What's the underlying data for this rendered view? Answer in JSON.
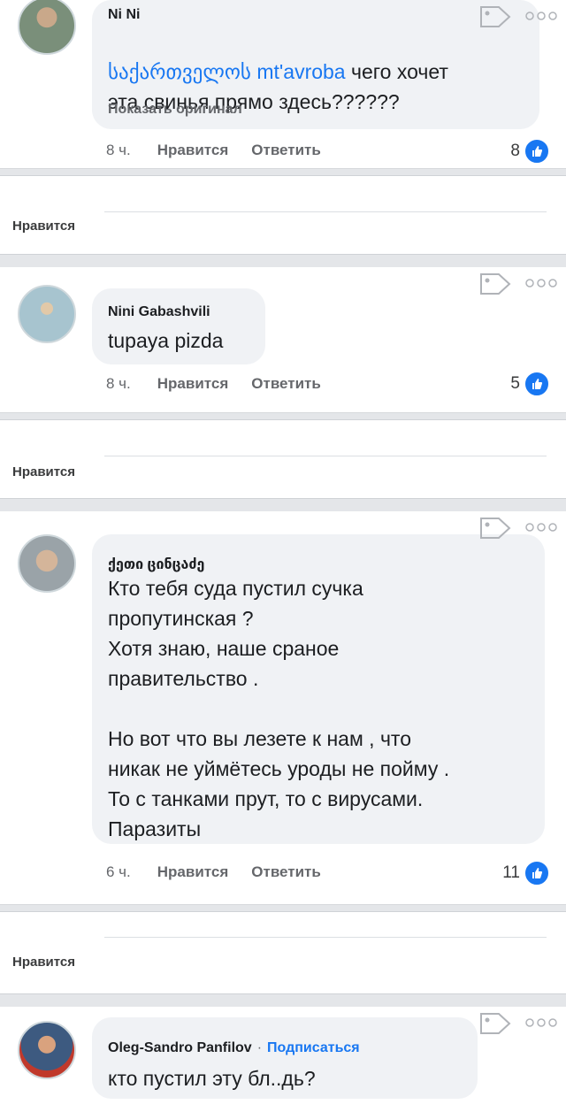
{
  "comments": [
    {
      "author": "Ni Ni",
      "text_prefix": "საქართველოს mt'avroba",
      "text": "чего хочет\nэта свинья прямо здесь??????",
      "show_original": "Показать оригинал",
      "time": "8 ч.",
      "like_action": "Нравится",
      "reply_action": "Ответить",
      "reactions": "8",
      "icons": {
        "avatar": "avatar-photo",
        "tag": "tag-icon",
        "more": "more-options-icon",
        "reaction": "like-thumb-icon"
      }
    },
    {
      "author": "Nini Gabashvili",
      "text": "tupaya pizda",
      "time": "8 ч.",
      "like_action": "Нравится",
      "reply_action": "Ответить",
      "reactions": "5"
    },
    {
      "author": "ქეთი ცინცაძე",
      "text": "Кто тебя суда пустил сучка\nпропутинская ?\nХотя знаю, наше сраное\nправительство .\n\nНо вот что вы лезете к нам , что\nникак не уймётесь уроды не пойму .\nТо с танками прут, то с вирусами.\nПаразиты",
      "time": "6 ч.",
      "like_action": "Нравится",
      "reply_action": "Ответить",
      "reactions": "11"
    },
    {
      "author": "Oleg-Sandro Panfilov",
      "separator": "·",
      "follow": "Подписаться",
      "text": "кто пустил эту бл..дь?"
    }
  ],
  "post_like_label": "Нравится",
  "colors": {
    "accent": "#1877f2",
    "bubble": "#f0f2f5",
    "page_bg": "#e4e6e9"
  }
}
